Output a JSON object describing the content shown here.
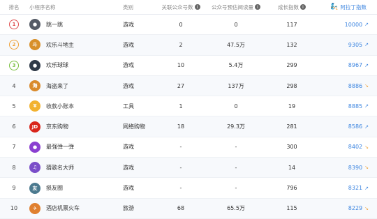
{
  "header": {
    "rank": "排名",
    "name": "小程序名称",
    "category": "类别",
    "associated": "关联公众号数",
    "reads": "公众号预估阅读量",
    "growth": "成长指数",
    "ali_brand": "阿拉丁指数",
    "info_symbol": "i"
  },
  "rows": [
    {
      "rank": "1",
      "name": "跳一跳",
      "category": "游戏",
      "associated": "0",
      "reads": "0",
      "growth": "117",
      "ali": "10000",
      "trend": "↗",
      "trend_color": "#3e86e0",
      "medal_color": "#e05252",
      "icon_color": "#555b66",
      "icon_glyph": "●"
    },
    {
      "rank": "2",
      "name": "欢乐斗地主",
      "category": "游戏",
      "associated": "2",
      "reads": "47.5万",
      "growth": "132",
      "ali": "9305",
      "trend": "↗",
      "trend_color": "#3e86e0",
      "medal_color": "#f0a33b",
      "icon_color": "#d8902a",
      "icon_glyph": "斗"
    },
    {
      "rank": "3",
      "name": "欢乐球球",
      "category": "游戏",
      "associated": "10",
      "reads": "5.4万",
      "growth": "299",
      "ali": "8967",
      "trend": "↗",
      "trend_color": "#3e86e0",
      "medal_color": "#7cc043",
      "icon_color": "#2f3a48",
      "icon_glyph": "●"
    },
    {
      "rank": "4",
      "name": "海盗来了",
      "category": "游戏",
      "associated": "27",
      "reads": "137万",
      "growth": "298",
      "ali": "8886",
      "trend": "↘",
      "trend_color": "#f0a33b",
      "medal_color": "",
      "icon_color": "#d98a2b",
      "icon_glyph": "海"
    },
    {
      "rank": "5",
      "name": "收款小账本",
      "category": "工具",
      "associated": "1",
      "reads": "0",
      "growth": "19",
      "ali": "8885",
      "trend": "↗",
      "trend_color": "#3e86e0",
      "medal_color": "",
      "icon_color": "#f2b230",
      "icon_glyph": "¥"
    },
    {
      "rank": "6",
      "name": "京东购物",
      "category": "网络购物",
      "associated": "18",
      "reads": "29.3万",
      "growth": "281",
      "ali": "8586",
      "trend": "↗",
      "trend_color": "#3e86e0",
      "medal_color": "",
      "icon_color": "#d9261c",
      "icon_glyph": "JD"
    },
    {
      "rank": "7",
      "name": "最强弹一弹",
      "category": "游戏",
      "associated": "-",
      "reads": "-",
      "growth": "300",
      "ali": "8402",
      "trend": "↘",
      "trend_color": "#f0a33b",
      "medal_color": "",
      "icon_color": "#8a3fd1",
      "icon_glyph": "●"
    },
    {
      "rank": "8",
      "name": "猜歌名大师",
      "category": "游戏",
      "associated": "-",
      "reads": "-",
      "growth": "14",
      "ali": "8390",
      "trend": "↘",
      "trend_color": "#f0a33b",
      "medal_color": "",
      "icon_color": "#7a4ec9",
      "icon_glyph": "♫"
    },
    {
      "rank": "9",
      "name": "损友圈",
      "category": "游戏",
      "associated": "-",
      "reads": "-",
      "growth": "796",
      "ali": "8321",
      "trend": "↗",
      "trend_color": "#3e86e0",
      "medal_color": "",
      "icon_color": "#4c7a8f",
      "icon_glyph": "友"
    },
    {
      "rank": "10",
      "name": "酒店机票火车",
      "category": "旅游",
      "associated": "68",
      "reads": "65.5万",
      "growth": "115",
      "ali": "8229",
      "trend": "↘",
      "trend_color": "#f0a33b",
      "medal_color": "",
      "icon_color": "#e0802f",
      "icon_glyph": "✈"
    }
  ]
}
